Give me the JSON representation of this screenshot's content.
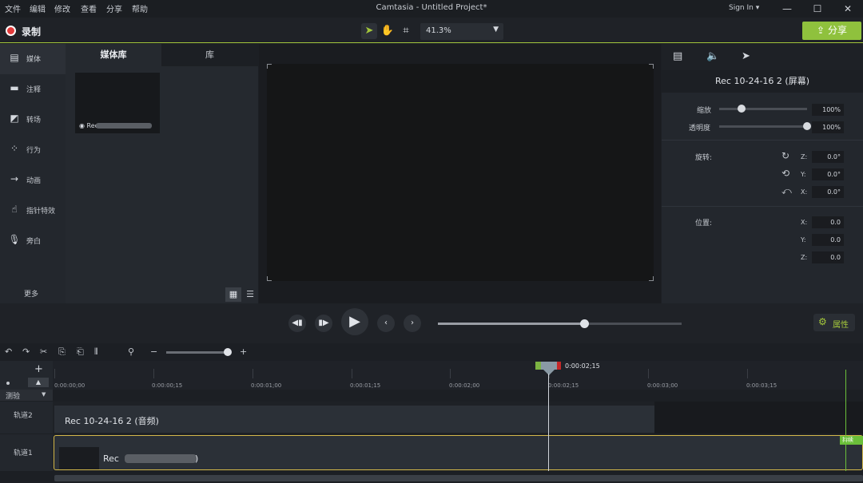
{
  "menu": [
    "文件",
    "编辑",
    "修改",
    "查看",
    "分享",
    "帮助"
  ],
  "app_title": "Camtasia - Untitled Project*",
  "signin": "Sign In ▾",
  "window_controls": {
    "minimize": "—",
    "maximize": "☐",
    "close": "✕"
  },
  "toolbar": {
    "record_label": "录制",
    "zoom": "41.3%",
    "share_label": "分享",
    "share_icon": "⇪"
  },
  "sidebar": {
    "items": [
      {
        "label": "媒体",
        "icon": "▤"
      },
      {
        "label": "注释",
        "icon": "▬"
      },
      {
        "label": "转场",
        "icon": "◩"
      },
      {
        "label": "行为",
        "icon": "⁘"
      },
      {
        "label": "动画",
        "icon": "→"
      },
      {
        "label": "指针特效",
        "icon": "☝"
      },
      {
        "label": "旁白",
        "icon": "🎙"
      }
    ],
    "more_label": "更多",
    "add_label": "+"
  },
  "media_panel": {
    "tabs": [
      "媒体库",
      "库"
    ],
    "thumb_label": "◉ Rec"
  },
  "properties": {
    "title": "Rec 10-24-16 2 (屏幕)",
    "scale_label": "缩放",
    "scale_value": "100%",
    "scale_level": 0.25,
    "opacity_label": "透明度",
    "opacity_value": "100%",
    "opacity_level": 1.0,
    "rotation_label": "旋转:",
    "rotation": [
      {
        "axis": "Z:",
        "value": "0.0°",
        "icon": "↻"
      },
      {
        "axis": "Y:",
        "value": "0.0°",
        "icon": "⟲"
      },
      {
        "axis": "X:",
        "value": "0.0°",
        "icon": "⤺"
      }
    ],
    "position_label": "位置:",
    "position": [
      {
        "axis": "X:",
        "value": "0.0"
      },
      {
        "axis": "Y:",
        "value": "0.0"
      },
      {
        "axis": "Z:",
        "value": "0.0"
      }
    ],
    "button_label": "属性",
    "button_icon": "⚙"
  },
  "playback": {
    "progress": 0.6
  },
  "timeline": {
    "playhead_time": "0:00:02;15",
    "ticks": [
      "0:00:00;00",
      "0:00:00;15",
      "0:00:01;00",
      "0:00:01;15",
      "0:00:02;00",
      "0:00:02;15",
      "0:00:03;00",
      "0:00:03;15"
    ],
    "test_label": "测验",
    "tracks": [
      {
        "name": "轨道2",
        "clip": "Rec 10-24-16 2 (音频)"
      },
      {
        "name": "轨道1",
        "clip": "Rec",
        "clip_suffix": ")"
      }
    ],
    "end_badge": "持续"
  }
}
